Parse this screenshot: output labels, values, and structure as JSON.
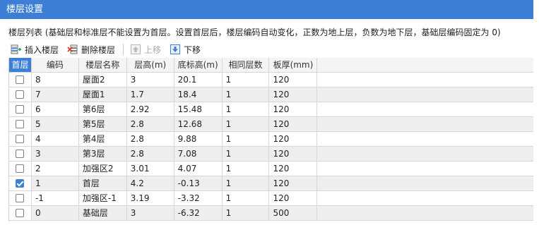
{
  "window": {
    "title": "楼层设置"
  },
  "description": "楼层列表 (基础层和标准层不能设置为首层。设置首层后，楼层编码自动变化，正数为地上层，负数为地下层，基础层编码固定为 0)",
  "toolbar": {
    "insert_label": "插入楼层",
    "delete_label": "删除楼层",
    "up_label": "上移",
    "down_label": "下移"
  },
  "table": {
    "headers": [
      "首层",
      "编码",
      "楼层名称",
      "层高(m)",
      "底标高(m)",
      "相同层数",
      "板厚(mm)",
      ""
    ],
    "rows": [
      {
        "first": false,
        "code": "8",
        "name": "屋面2",
        "height": "3",
        "base": "20.1",
        "same": "1",
        "slab": "120"
      },
      {
        "first": false,
        "code": "7",
        "name": "屋面1",
        "height": "1.7",
        "base": "18.4",
        "same": "1",
        "slab": "120"
      },
      {
        "first": false,
        "code": "6",
        "name": "第6层",
        "height": "2.92",
        "base": "15.48",
        "same": "1",
        "slab": "120"
      },
      {
        "first": false,
        "code": "5",
        "name": "第5层",
        "height": "2.8",
        "base": "12.68",
        "same": "1",
        "slab": "120"
      },
      {
        "first": false,
        "code": "4",
        "name": "第4层",
        "height": "2.8",
        "base": "9.88",
        "same": "1",
        "slab": "120"
      },
      {
        "first": false,
        "code": "3",
        "name": "第3层",
        "height": "2.8",
        "base": "7.08",
        "same": "1",
        "slab": "120"
      },
      {
        "first": false,
        "code": "2",
        "name": "加强区2",
        "height": "3.01",
        "base": "4.07",
        "same": "1",
        "slab": "120"
      },
      {
        "first": true,
        "code": "1",
        "name": "首层",
        "height": "4.2",
        "base": "-0.13",
        "same": "1",
        "slab": "120"
      },
      {
        "first": false,
        "code": "-1",
        "name": "加强区-1",
        "height": "3.19",
        "base": "-3.32",
        "same": "1",
        "slab": "120"
      },
      {
        "first": false,
        "code": "0",
        "name": "基础层",
        "height": "3",
        "base": "-6.32",
        "same": "1",
        "slab": "500"
      }
    ]
  },
  "icons": {
    "insert": "insert-floor-icon",
    "delete": "delete-floor-icon",
    "up": "arrow-up-icon",
    "down": "arrow-down-icon"
  },
  "colors": {
    "accent": "#3d7fd6",
    "alt_row": "#eeeeee",
    "delete_x": "#d9342b"
  }
}
